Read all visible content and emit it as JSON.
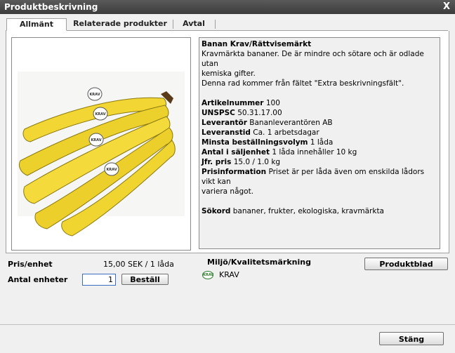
{
  "window": {
    "title": "Produktbeskrivning",
    "close_label": "X"
  },
  "tabs": [
    {
      "label": "Allmänt",
      "active": true
    },
    {
      "label": "Relaterade produkter",
      "active": false
    },
    {
      "label": "Avtal",
      "active": false
    }
  ],
  "product": {
    "name": "Banan Krav/Rättvisemärkt",
    "desc1": "Kravmärkta bananer. De är mindre och sötare och är odlade utan",
    "desc2": "kemiska gifter.",
    "desc3": "Denna rad kommer från fältet \"Extra beskrivningsfält\".",
    "fields": [
      {
        "label": "Artikelnummer",
        "value": "100"
      },
      {
        "label": "UNSPSC",
        "value": "50.31.17.00"
      },
      {
        "label": "Leverantör",
        "value": "Bananleverantören AB"
      },
      {
        "label": "Leveranstid",
        "value": "Ca. 1 arbetsdagar"
      },
      {
        "label": "Minsta beställningsvolym",
        "value": "1 låda"
      },
      {
        "label": "Antal i säljenhet",
        "value": "1 låda innehåller 10 kg"
      },
      {
        "label": "Jfr. pris",
        "value": "15.0  / 1.0 kg"
      }
    ],
    "prisinfo_label": "Prisinformation",
    "prisinfo_text1": "Priset är per låda även om enskilda lådors vikt kan",
    "prisinfo_text2": "variera något.",
    "sokord_label": "Sökord",
    "sokord_value": "bananer, frukter, ekologiska, kravmärkta",
    "sticker_text": "KRAV"
  },
  "order": {
    "price_label": "Pris/enhet",
    "price_value": "15,00 SEK  / 1 låda",
    "qty_label": "Antal enheter",
    "qty_value": "1",
    "order_button": "Beställ"
  },
  "eco": {
    "heading": "Miljö/Kvalitetsmärkning",
    "icon_text": "KRAV",
    "label": "KRAV"
  },
  "buttons": {
    "product_sheet": "Produktblad",
    "close": "Stäng"
  }
}
